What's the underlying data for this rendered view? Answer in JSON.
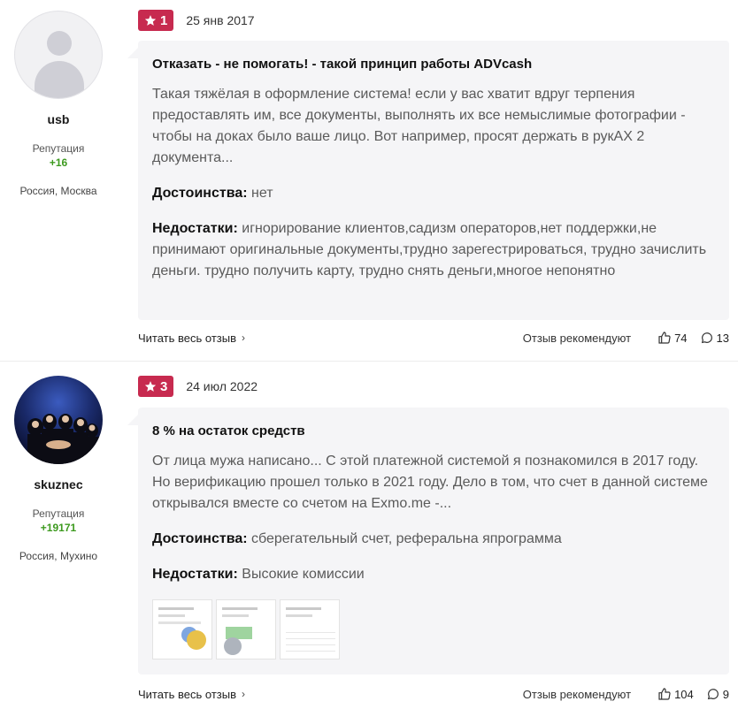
{
  "reviews": [
    {
      "author": {
        "name": "usb",
        "reputation_label": "Репутация",
        "reputation_value": "+16",
        "location": "Россия, Москва",
        "avatar": "avatar-placeholder-icon"
      },
      "rating": "1",
      "date": "25 янв 2017",
      "title": "Отказать - не помогать! - такой принцип работы ADVcash",
      "text": "Такая тяжёлая в оформление система! если у вас хватит вдруг терпения предоставлять им, все документы, выполнять их все немыслимые фотографии - чтобы на доках было ваше лицо. Вот например, просят держать в рукАХ 2 документа...",
      "pros_label": "Достоинства:",
      "pros": "нет",
      "cons_label": "Недостатки:",
      "cons": "игнорирование клиентов,садизм операторов,нет поддержки,не принимают оригинальные документы,трудно зарегестрироваться, трудно зачислить деньги. трудно получить карту, трудно снять деньги,многое непонятно",
      "read_more": "Читать весь отзыв",
      "recommend": "Отзыв рекомендуют",
      "likes": "74",
      "comments": "13"
    },
    {
      "author": {
        "name": "skuznec",
        "reputation_label": "Репутация",
        "reputation_value": "+19171",
        "location": "Россия, Мухино",
        "avatar": "user-photo"
      },
      "rating": "3",
      "date": "24 июл 2022",
      "title": "8 % на остаток средств",
      "text": "От лица мужа написано... С этой платежной системой я познакомился в 2017 году. Но верификацию прошел только в 2021 году. Дело в том, что счет в данной системе открывался вместе со счетом на Exmo.me -...",
      "pros_label": "Достоинства:",
      "pros": "сберегательный счет, реферальна япрограмма",
      "cons_label": "Недостатки:",
      "cons": "Высокие комиссии",
      "read_more": "Читать весь отзыв",
      "recommend": "Отзыв рекомендуют",
      "likes": "104",
      "comments": "9"
    }
  ],
  "colors": {
    "rating_badge": "#c72a4f",
    "reputation": "#3d9a1f",
    "card_bg": "#f5f5f7"
  }
}
